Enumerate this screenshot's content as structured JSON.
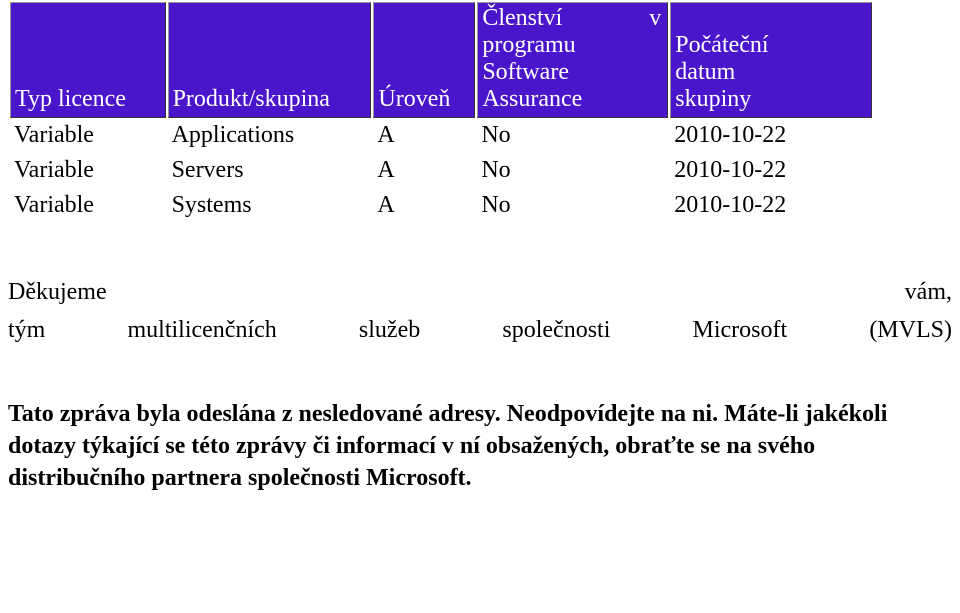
{
  "table": {
    "headers": {
      "col0": "Typ licence",
      "col1": "Produkt/skupina",
      "col2": "Úroveň",
      "col3_line1": "Členství",
      "col3_line1b": "v",
      "col3_line2": "programu",
      "col3_line3": "Software",
      "col3_line4": "Assurance",
      "col4_line1": "Počáteční",
      "col4_line2": "datum",
      "col4_line3": "skupiny"
    },
    "rows": [
      {
        "c0": "Variable",
        "c1": "Applications",
        "c2": "A",
        "c3": "No",
        "c4": "2010-10-22"
      },
      {
        "c0": "Variable",
        "c1": "Servers",
        "c2": "A",
        "c3": "No",
        "c4": "2010-10-22"
      },
      {
        "c0": "Variable",
        "c1": "Systems",
        "c2": "A",
        "c3": "No",
        "c4": "2010-10-22"
      }
    ]
  },
  "closing": {
    "line1_left": "Děkujeme",
    "line1_right": "vám,",
    "line2_w1": "tým",
    "line2_w2": "multilicenčních",
    "line2_w3": "služeb",
    "line2_w4": "společnosti",
    "line2_w5": "Microsoft",
    "line2_w6": "(MVLS)"
  },
  "footer": {
    "text": "Tato zpráva byla odeslána z nesledované adresy. Neodpovídejte na ni. Máte-li jakékoli dotazy týkající se této zprávy či informací v ní obsažených, obraťte se na svého distribučního partnera společnosti Microsoft."
  },
  "colors": {
    "header_bg": "#4a16cc"
  }
}
